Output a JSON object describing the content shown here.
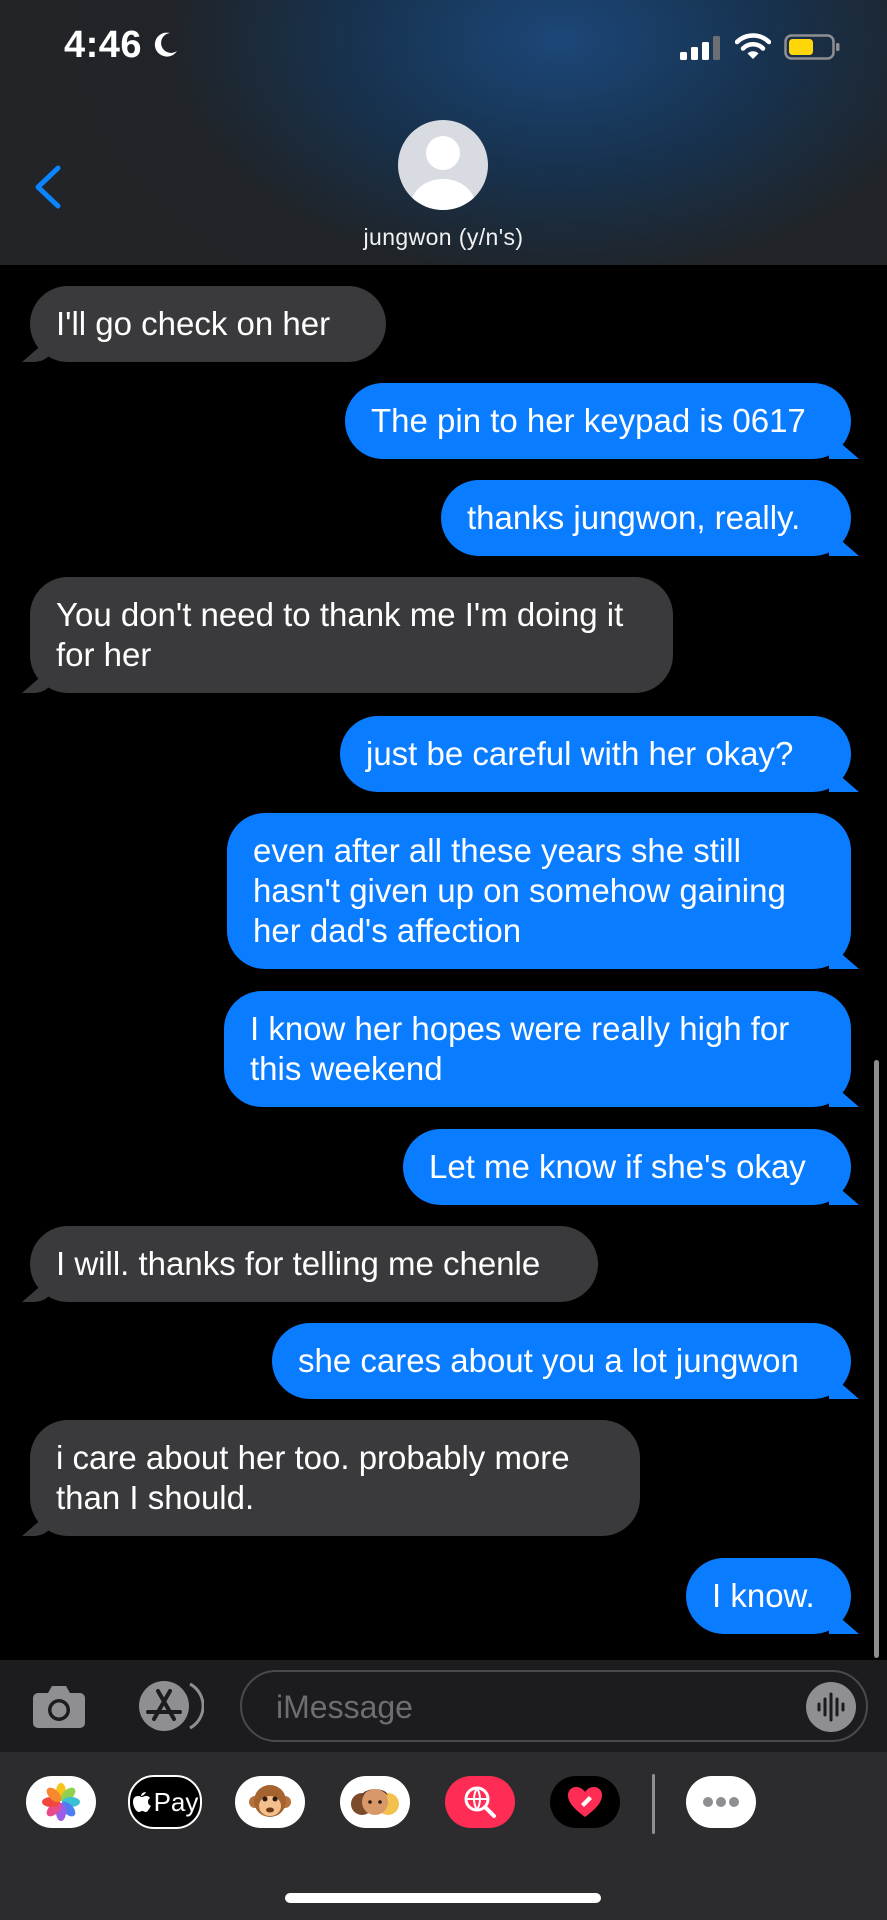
{
  "status_bar": {
    "time": "4:46"
  },
  "header": {
    "contact_name": "jungwon (y/n's)"
  },
  "messages": [
    {
      "from": "them",
      "text": "I'll go check on her"
    },
    {
      "from": "me",
      "text": "The pin to her keypad is 0617"
    },
    {
      "from": "me",
      "text": "thanks jungwon, really."
    },
    {
      "from": "them",
      "text": "You don't need to thank me I'm doing it for her"
    },
    {
      "from": "me",
      "text": "just be careful with her okay?"
    },
    {
      "from": "me",
      "text": "even after all these years she still hasn't given up on somehow gaining her dad's affection"
    },
    {
      "from": "me",
      "text": "I know her hopes were really high for this weekend"
    },
    {
      "from": "me",
      "text": "Let me know if she's okay"
    },
    {
      "from": "them",
      "text": "I will. thanks for telling me chenle"
    },
    {
      "from": "me",
      "text": "she cares about you a lot jungwon"
    },
    {
      "from": "them",
      "text": "i care about her too. probably more than I should."
    },
    {
      "from": "me",
      "text": "I know."
    }
  ],
  "composer": {
    "placeholder": "iMessage"
  },
  "app_drawer": {
    "apps": [
      "photos-app",
      "apple-pay-app",
      "animoji-app",
      "memoji-app",
      "search-images-app",
      "digital-touch-app",
      "more-apps"
    ],
    "apple_pay_label": "Pay"
  },
  "colors": {
    "outgoing": "#0a7cff",
    "incoming": "#3a3a3c",
    "accent": "#0a84ff"
  }
}
